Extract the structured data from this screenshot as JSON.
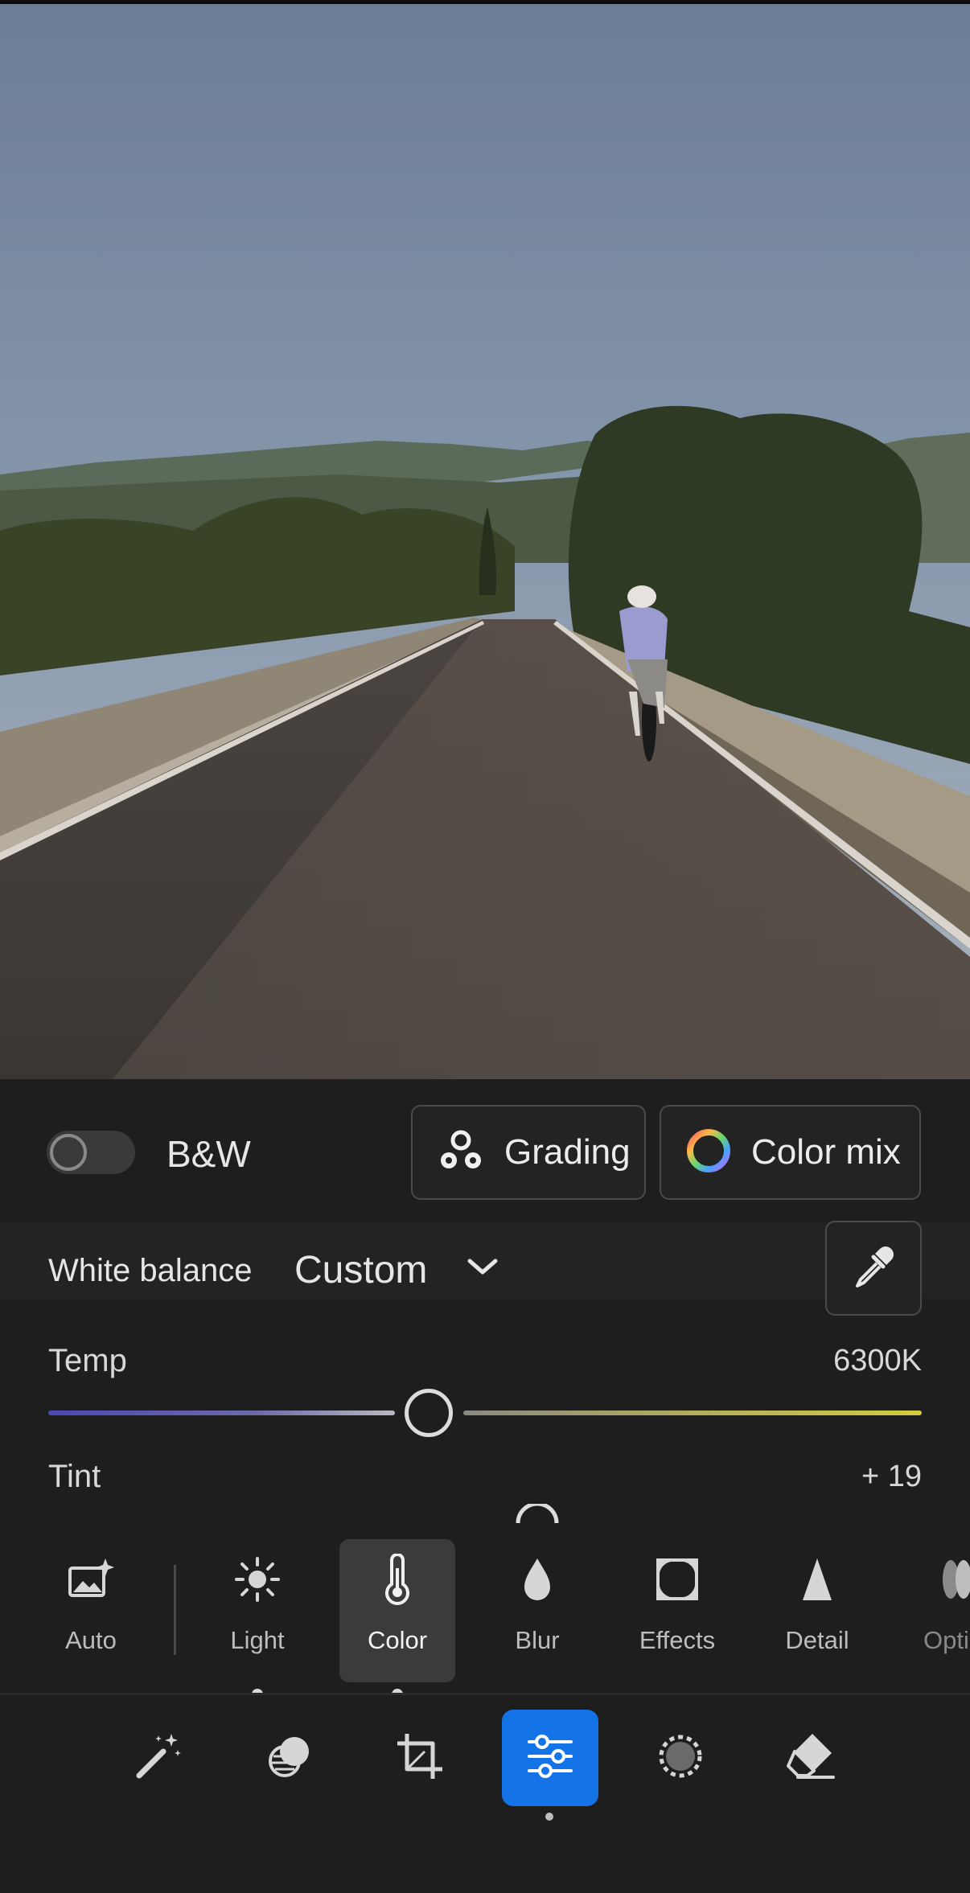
{
  "panel": {
    "bw_label": "B&W",
    "bw_enabled": false,
    "grading_label": "Grading",
    "color_mix_label": "Color mix"
  },
  "white_balance": {
    "label": "White balance",
    "value": "Custom"
  },
  "sliders": {
    "temp": {
      "label": "Temp",
      "value": "6300K",
      "position": 0.436
    },
    "tint": {
      "label": "Tint",
      "value": "+ 19"
    }
  },
  "tools": [
    {
      "id": "auto",
      "label": "Auto",
      "icon": "auto-sparkle-image-icon"
    },
    {
      "id": "light",
      "label": "Light",
      "icon": "sun-icon"
    },
    {
      "id": "color",
      "label": "Color",
      "icon": "thermometer-icon",
      "selected": true
    },
    {
      "id": "blur",
      "label": "Blur",
      "icon": "droplet-icon"
    },
    {
      "id": "effects",
      "label": "Effects",
      "icon": "vignette-frame-icon"
    },
    {
      "id": "detail",
      "label": "Detail",
      "icon": "triangle-icon"
    },
    {
      "id": "optics",
      "label": "Opti",
      "icon": "lens-icon"
    }
  ],
  "bottom_bar": [
    {
      "id": "edit-wand",
      "icon": "magic-wand-icon"
    },
    {
      "id": "presets",
      "icon": "presets-overlap-icon"
    },
    {
      "id": "crop",
      "icon": "crop-icon"
    },
    {
      "id": "adjust",
      "icon": "sliders-icon",
      "active": true
    },
    {
      "id": "masking",
      "icon": "masking-circle-icon"
    },
    {
      "id": "remove",
      "icon": "eraser-icon"
    }
  ],
  "colors": {
    "accent": "#1473e6",
    "panel_bg": "#1e1e1e",
    "temp_cool": "#4b48b8",
    "temp_warm": "#d4cb3e"
  }
}
